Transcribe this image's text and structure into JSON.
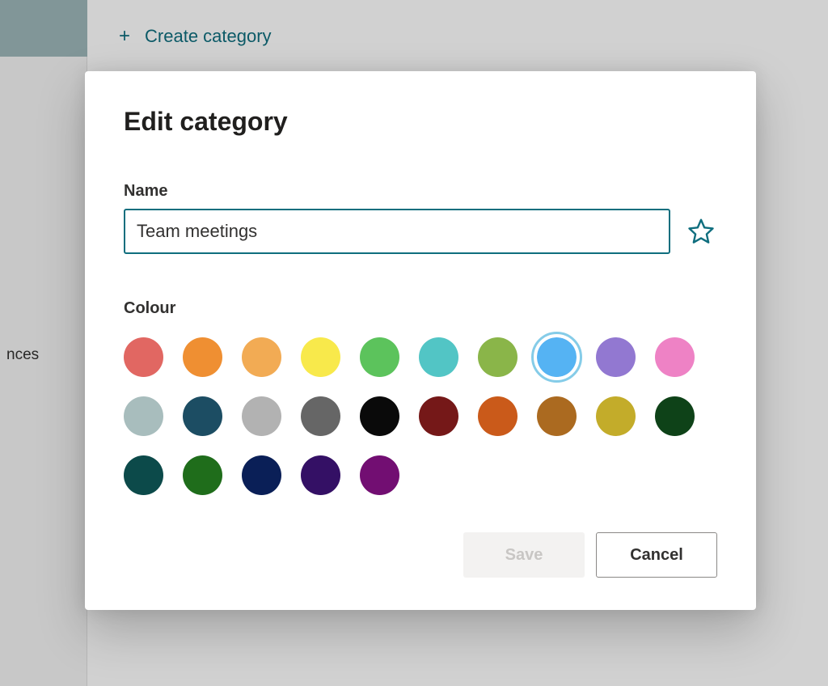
{
  "background": {
    "create_category_label": "Create category",
    "sidebar_text": "nces"
  },
  "dialog": {
    "title": "Edit category",
    "name_label": "Name",
    "name_value": "Team meetings",
    "colour_label": "Colour",
    "colours": [
      {
        "name": "red",
        "hex": "#e16762",
        "selected": false
      },
      {
        "name": "orange",
        "hex": "#ef8f32",
        "selected": false
      },
      {
        "name": "peach",
        "hex": "#f2ab54",
        "selected": false
      },
      {
        "name": "yellow",
        "hex": "#f8e94b",
        "selected": false
      },
      {
        "name": "green",
        "hex": "#5cc35c",
        "selected": false
      },
      {
        "name": "teal",
        "hex": "#52c5c5",
        "selected": false
      },
      {
        "name": "olive",
        "hex": "#8ab549",
        "selected": false
      },
      {
        "name": "blue",
        "hex": "#55b3f3",
        "selected": true
      },
      {
        "name": "purple",
        "hex": "#9278d1",
        "selected": false
      },
      {
        "name": "pink",
        "hex": "#ee82c5",
        "selected": false
      },
      {
        "name": "steel",
        "hex": "#a8bdbd",
        "selected": false
      },
      {
        "name": "dark-steel",
        "hex": "#1c4d63",
        "selected": false
      },
      {
        "name": "grey",
        "hex": "#b2b2b2",
        "selected": false
      },
      {
        "name": "dark-grey",
        "hex": "#666666",
        "selected": false
      },
      {
        "name": "black",
        "hex": "#0a0a0a",
        "selected": false
      },
      {
        "name": "dark-red",
        "hex": "#751818",
        "selected": false
      },
      {
        "name": "dark-orange",
        "hex": "#ca5a1a",
        "selected": false
      },
      {
        "name": "brown",
        "hex": "#ab6a20",
        "selected": false
      },
      {
        "name": "dark-yellow",
        "hex": "#c3ac2a",
        "selected": false
      },
      {
        "name": "dark-green",
        "hex": "#0e4218",
        "selected": false
      },
      {
        "name": "dark-teal",
        "hex": "#0c4a4a",
        "selected": false
      },
      {
        "name": "dark-olive",
        "hex": "#1f6d1b",
        "selected": false
      },
      {
        "name": "dark-blue",
        "hex": "#0a1f57",
        "selected": false
      },
      {
        "name": "dark-purple",
        "hex": "#341065",
        "selected": false
      },
      {
        "name": "dark-pink",
        "hex": "#720e72",
        "selected": false
      }
    ],
    "actions": {
      "save_label": "Save",
      "cancel_label": "Cancel"
    }
  }
}
